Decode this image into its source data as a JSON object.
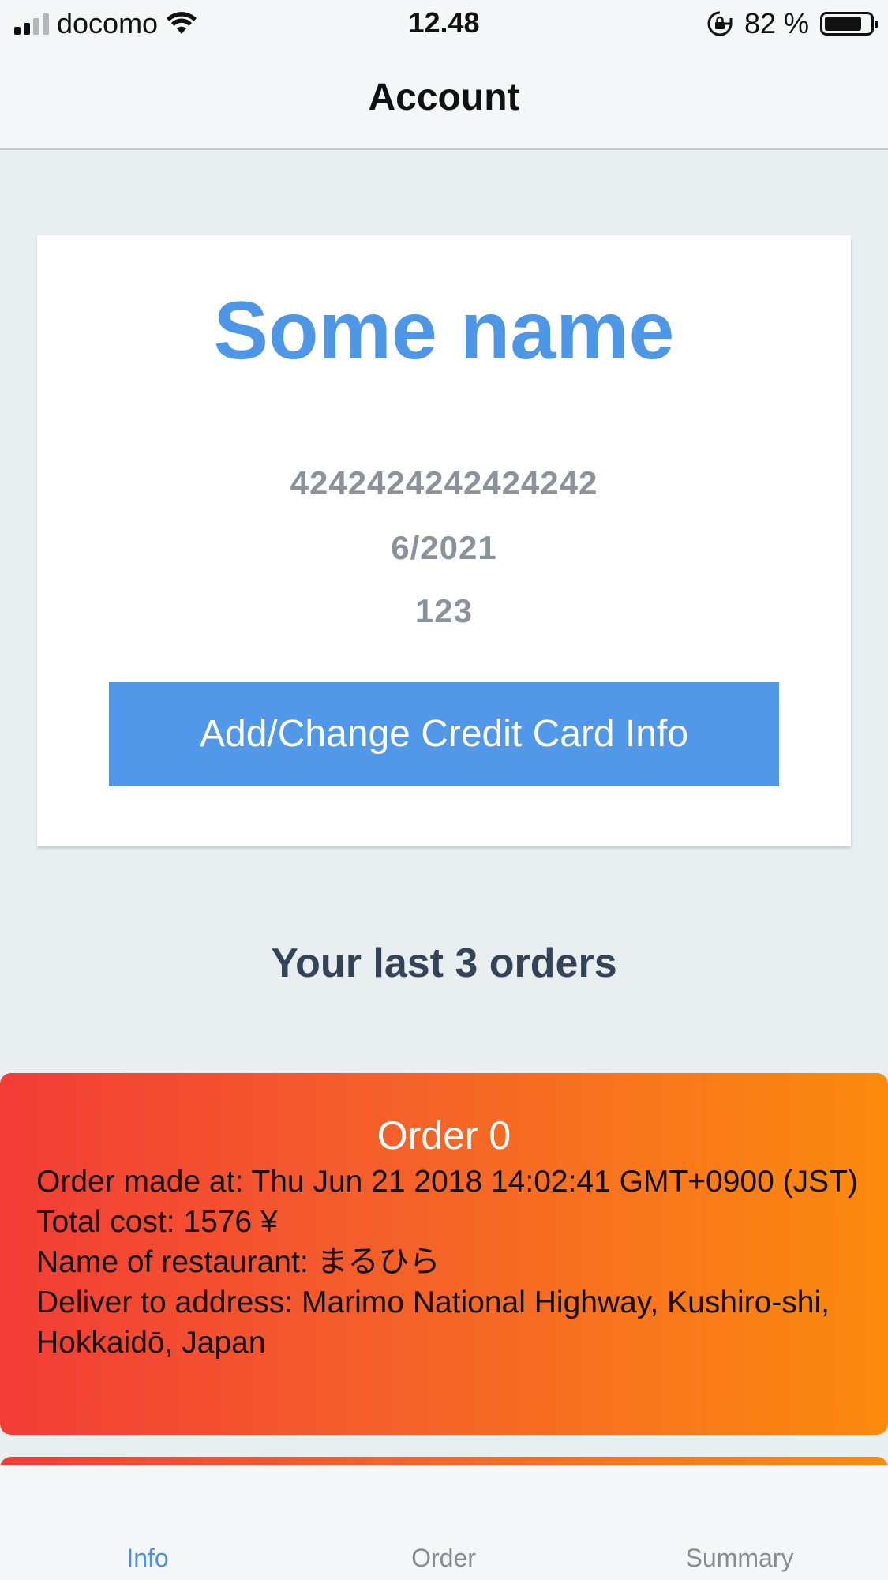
{
  "status": {
    "carrier": "docomo",
    "time": "12.48",
    "battery": "82 %",
    "battery_level": 0.82
  },
  "nav": {
    "title": "Account"
  },
  "profile": {
    "name": "Some name",
    "card_number": "4242424242424242",
    "card_expiry": "6/2021",
    "card_cvc": "123",
    "button_label": "Add/Change Credit Card Info"
  },
  "orders": {
    "heading": "Your last 3 orders",
    "items": [
      {
        "title": "Order 0",
        "made_at": "Order made at: Thu Jun 21 2018 14:02:41 GMT+0900 (JST)",
        "total": "Total cost: 1576 ¥",
        "restaurant": "Name of restaurant: まるひら",
        "address": "Deliver to address: Marimo National Highway, Kushiro-shi, Hokkaidō, Japan"
      }
    ]
  },
  "tabs": [
    {
      "label": "Info",
      "active": true
    },
    {
      "label": "Order",
      "active": false
    },
    {
      "label": "Summary",
      "active": false
    }
  ],
  "colors": {
    "accent": "#4d97e6",
    "button": "#5298e8",
    "order_gradient_start": "#f23c36",
    "order_gradient_end": "#fb8b0e"
  }
}
